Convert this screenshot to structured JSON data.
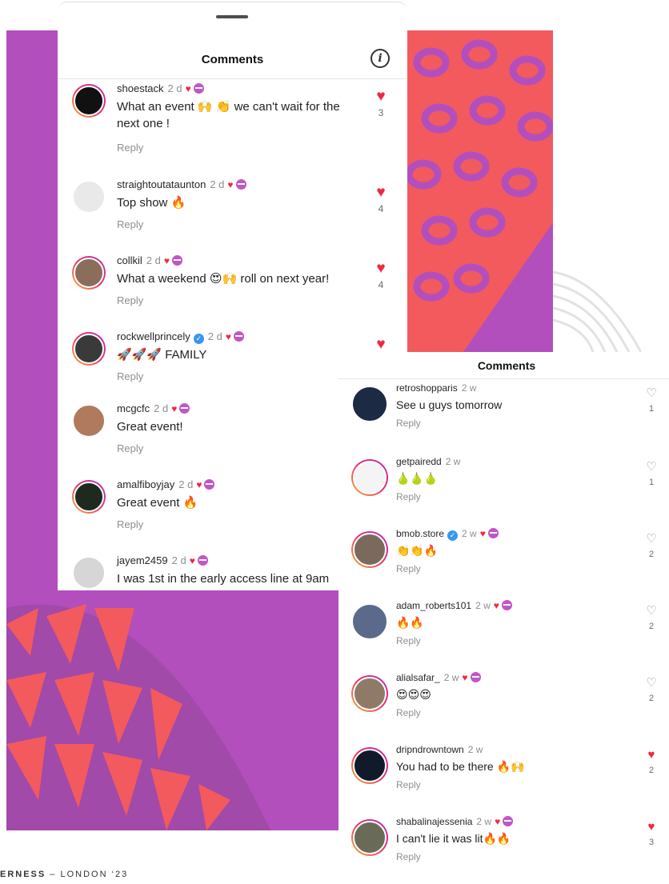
{
  "footer": {
    "left": "ERNESS",
    "rest": " – LONDON ‘23"
  },
  "cut_text": "Se",
  "panel1": {
    "title": "Comments",
    "comments": [
      {
        "user": "shoestack",
        "time": "2 d",
        "text": "What an event 🙌 👏 we can't wait for the next one !",
        "reply": "Reply",
        "likes": "3",
        "avatar_color": "#111111"
      },
      {
        "user": "straightoutataunton",
        "time": "2 d",
        "text": "Top show 🔥",
        "reply": "Reply",
        "likes": "4",
        "avatar_color": "#e9e9e9"
      },
      {
        "user": "collkil",
        "time": "2 d",
        "text": "What a weekend 😍🙌 roll on next year!",
        "reply": "Reply",
        "likes": "4",
        "avatar_color": "#8a6e5a"
      },
      {
        "user": "rockwellprincely",
        "time": "2 d",
        "text": "🚀🚀🚀 FAMILY",
        "reply": "Reply",
        "likes": "",
        "avatar_color": "#3a3a3a"
      },
      {
        "user": "mcgcfc",
        "time": "2 d",
        "text": "Great event!",
        "reply": "Reply",
        "likes": "",
        "avatar_color": "#b07a5e"
      },
      {
        "user": "amalfiboyjay",
        "time": "2 d",
        "text": "Great event 🔥",
        "reply": "Reply",
        "likes": "",
        "avatar_color": "#1f2a1f"
      },
      {
        "user": "jayem2459",
        "time": "2 d",
        "text": "I was 1st in the early access line at 9am",
        "reply": "",
        "likes": "",
        "avatar_color": "#d6d6d6"
      }
    ]
  },
  "panel2": {
    "title": "Comments",
    "comments": [
      {
        "user": "retroshopparis",
        "time": "2 w",
        "text": "See u guys tomorrow",
        "reply": "Reply",
        "likes": "1",
        "liked": false,
        "avatar_color": "#1c2a44"
      },
      {
        "user": "getpairedd",
        "time": "2 w",
        "text": "🍐🍐🍐",
        "reply": "Reply",
        "likes": "1",
        "liked": false,
        "avatar_color": "#f4f4f4"
      },
      {
        "user": "bmob.store",
        "time": "2 w",
        "text": "👏👏🔥",
        "reply": "Reply",
        "likes": "2",
        "liked": false,
        "avatar_color": "#7a6a5e"
      },
      {
        "user": "adam_roberts101",
        "time": "2 w",
        "text": "🔥🔥",
        "reply": "Reply",
        "likes": "2",
        "liked": false,
        "avatar_color": "#5b6a8a"
      },
      {
        "user": "alialsafar_",
        "time": "2 w",
        "text": "😍😍😍",
        "reply": "Reply",
        "likes": "2",
        "liked": false,
        "avatar_color": "#8e7a66"
      },
      {
        "user": "dripndrowntown",
        "time": "2 w",
        "text": "You had to be there 🔥🙌",
        "reply": "Reply",
        "likes": "2",
        "liked": true,
        "avatar_color": "#101a2a"
      },
      {
        "user": "shabalinajessenia",
        "time": "2 w",
        "text": "I can't lie it was lit🔥🔥",
        "reply": "Reply",
        "likes": "3",
        "liked": true,
        "avatar_color": "#6a6a58"
      }
    ]
  }
}
